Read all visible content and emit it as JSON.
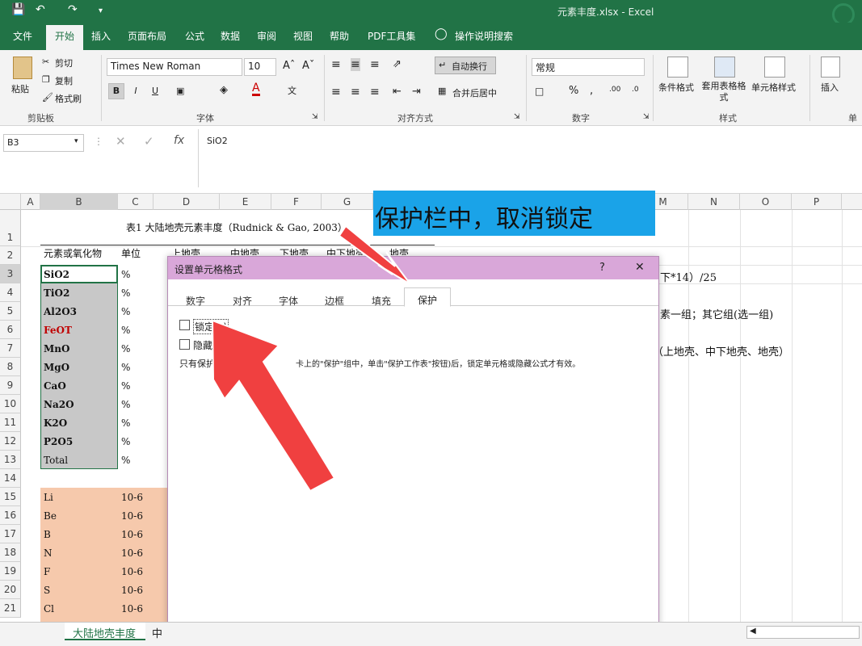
{
  "title_bar": {
    "doc_title": "元素丰度.xlsx - Excel"
  },
  "tabs": [
    "文件",
    "开始",
    "插入",
    "页面布局",
    "公式",
    "数据",
    "审阅",
    "视图",
    "帮助",
    "PDF工具集"
  ],
  "tell_me": "操作说明搜索",
  "ribbon": {
    "clipboard": {
      "paste": "粘贴",
      "cut": "剪切",
      "copy": "复制",
      "format_painter": "格式刷",
      "label": "剪贴板"
    },
    "font": {
      "name": "Times New Roman",
      "size": "10",
      "bold": "B",
      "italic": "I",
      "underline": "U",
      "label": "字体"
    },
    "alignment": {
      "wrap": "自动换行",
      "merge": "合并后居中",
      "label": "对齐方式"
    },
    "number": {
      "format": "常规",
      "label": "数字"
    },
    "styles": {
      "conditional": "条件格式",
      "table": "套用表格格式",
      "cell": "单元格样式",
      "label": "样式"
    },
    "cells": {
      "insert": "插入",
      "label": "单元"
    }
  },
  "formula_bar": {
    "namebox": "B3",
    "value": "SiO2"
  },
  "columns": [
    "A",
    "B",
    "C",
    "D",
    "E",
    "F",
    "G",
    "M",
    "N",
    "O",
    "P"
  ],
  "rows": [
    "1",
    "2",
    "3",
    "4",
    "5",
    "6",
    "7",
    "8",
    "9",
    "10",
    "11",
    "12",
    "13",
    "14",
    "15",
    "16",
    "17",
    "18",
    "19",
    "20",
    "21"
  ],
  "sheet": {
    "table_title": "表1 大陆地壳元素丰度（Rudnick & Gao, 2003）",
    "header_b": "元素或氧化物",
    "header_c": "单位",
    "header_d": "上地壳",
    "header_e": "中地壳",
    "header_f": "下地壳",
    "header_g": "中下地壳",
    "header_h": "地壳",
    "oxides": [
      "SiO2",
      "TiO2",
      "Al2O3",
      "FeOT",
      "MnO",
      "MgO",
      "CaO",
      "Na2O",
      "K2O",
      "P2O5",
      "Total"
    ],
    "oxide_unit": "%",
    "elements": [
      "Li",
      "Be",
      "B",
      "N",
      "F",
      "S",
      "Cl"
    ],
    "element_unit": "10-6",
    "right_notes": [
      "下*14）/25",
      "素一组；其它组(选一组)",
      "（上地壳、中下地壳、地壳）"
    ]
  },
  "annotation": {
    "text": "保护栏中，取消锁定",
    "bg": "#1aa3e8"
  },
  "dialog": {
    "title": "设置单元格格式",
    "help": "?",
    "close": "✕",
    "tabs": [
      "数字",
      "对齐",
      "字体",
      "边框",
      "填充",
      "保护"
    ],
    "locked_label": "锁定(L)",
    "hidden_label": "隐藏(I)",
    "note_a": "只有保护工",
    "note_b": "卡上的\"保护\"组中，单击\"保护工作表\"按钮)后，锁定单元格或隐藏公式才有效。"
  },
  "sheet_tabs": {
    "active": "大陆地壳丰度",
    "next": "中"
  },
  "colors": {
    "excel_green": "#217346",
    "oxide_fill": "#c8c8c8",
    "element_fill": "#f6c9ac",
    "arrow": "#f04040",
    "feot": "#c00000"
  }
}
